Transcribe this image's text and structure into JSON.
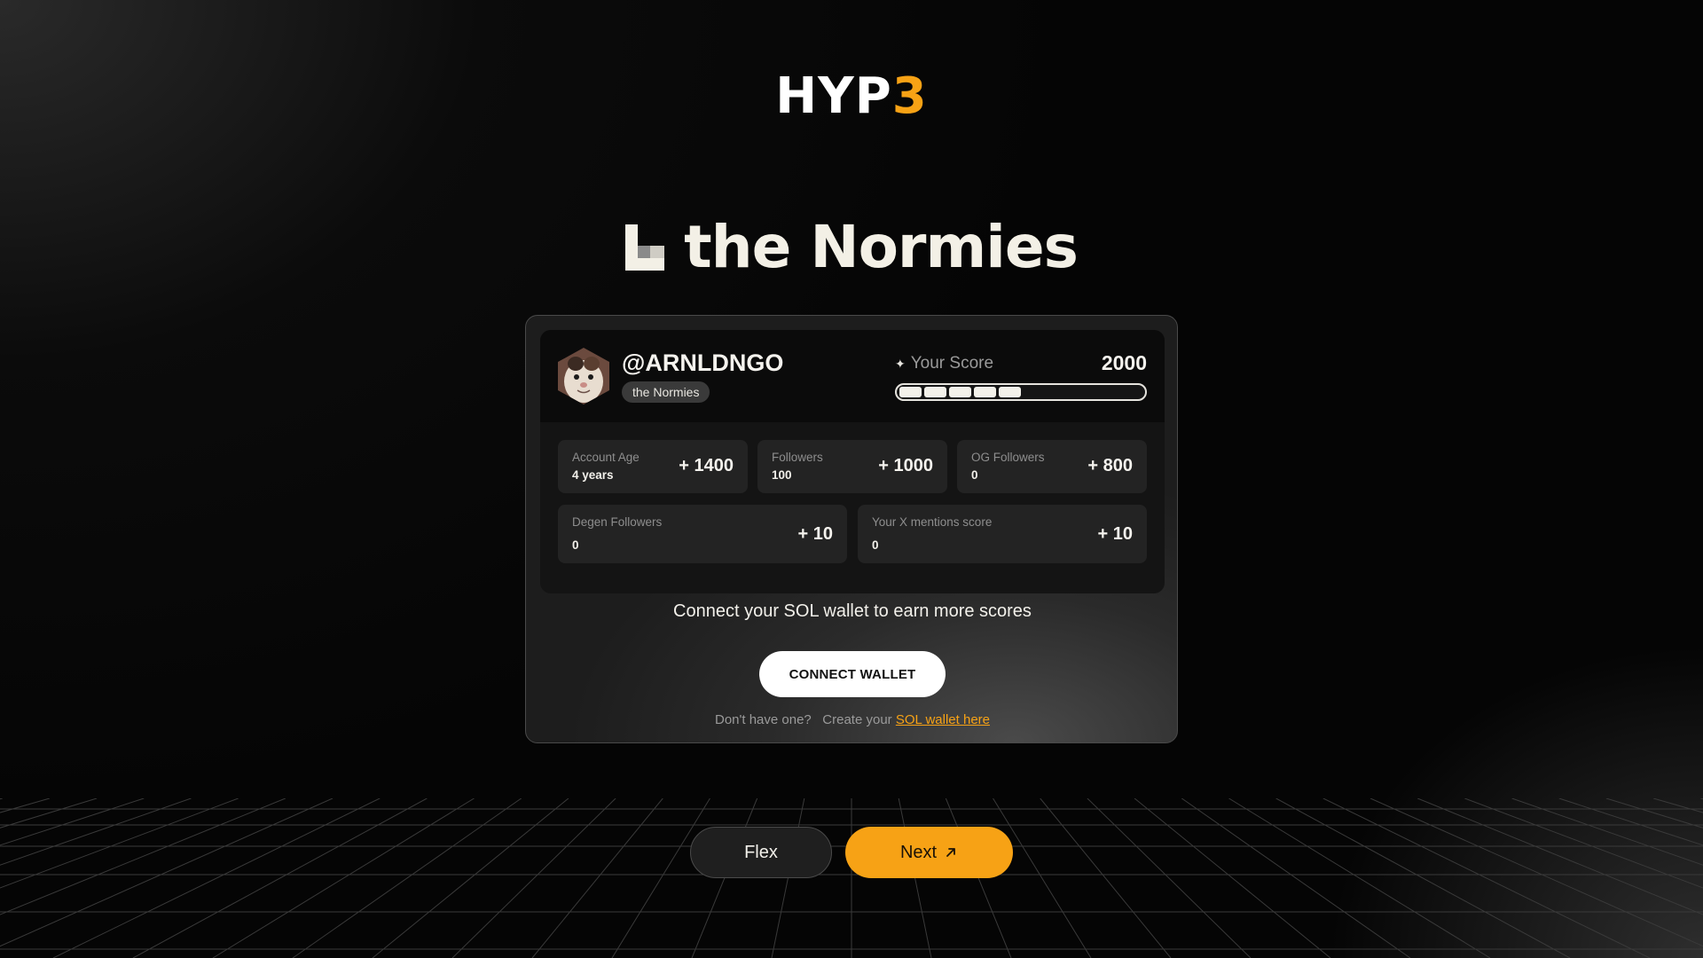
{
  "logo": {
    "main": "HYP",
    "accent": "3"
  },
  "heading": {
    "title": "the Normies"
  },
  "profile": {
    "username": "@ARNLDNGO",
    "tier": "the Normies",
    "score_label": "Your Score",
    "score": "2000",
    "progress_filled_segments": 5
  },
  "stats": [
    {
      "label": "Account Age",
      "value": "4 years",
      "points": "+ 1400"
    },
    {
      "label": "Followers",
      "value": "100",
      "points": "+ 1000"
    },
    {
      "label": "OG Followers",
      "value": "0",
      "points": "+ 800"
    },
    {
      "label": "Degen Followers",
      "value": "0",
      "points": "+ 10"
    },
    {
      "label": "Your X mentions score",
      "value": "0",
      "points": "+ 10"
    }
  ],
  "wallet": {
    "prompt": "Connect your SOL wallet to earn more scores",
    "connect_label": "CONNECT WALLET",
    "helper_prefix": "Don't have one?",
    "helper_middle": "Create your",
    "helper_link": "SOL wallet here"
  },
  "actions": {
    "flex_label": "Flex",
    "next_label": "Next"
  },
  "colors": {
    "accent": "#f7a215",
    "background": "#050505",
    "card": "#2a2a2a"
  },
  "icons": [
    "normies-logo-icon",
    "sparkle-icon",
    "arrow-up-right-icon",
    "avatar-cat"
  ]
}
